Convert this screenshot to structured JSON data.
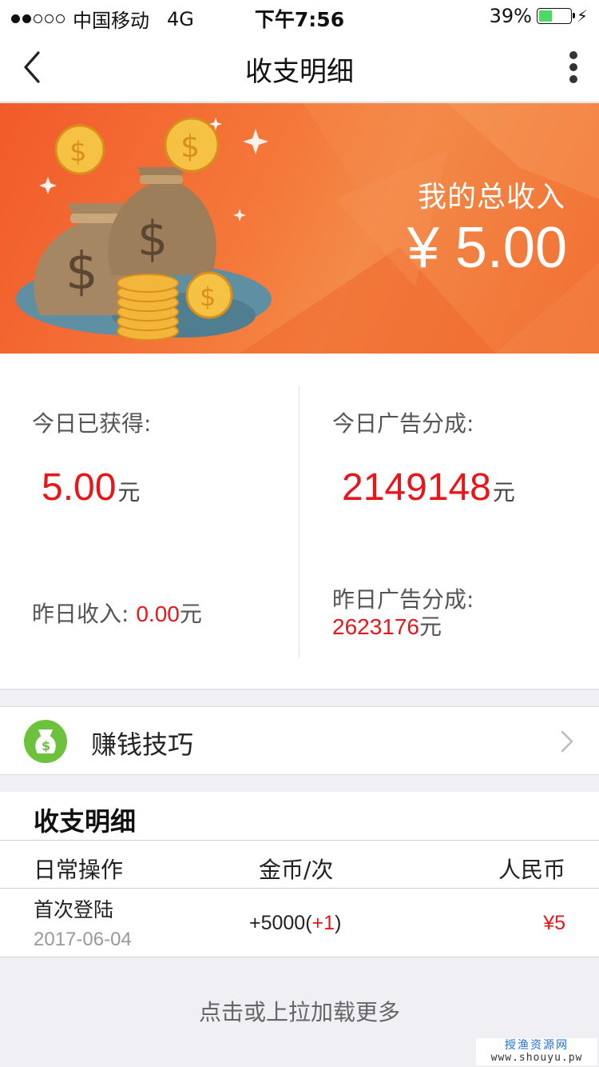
{
  "status_bar": {
    "carrier": "中国移动",
    "network": "4G",
    "time": "下午7:56",
    "battery": "39%",
    "battery_level": 0.39
  },
  "nav": {
    "title": "收支明细"
  },
  "banner": {
    "label": "我的总收入",
    "amount": "¥ 5.00"
  },
  "stats": {
    "today_earned_label": "今日已获得:",
    "today_earned_value": "5.00",
    "yesterday_income_label": "昨日收入:",
    "yesterday_income_value": "0.00",
    "today_ad_share_label": "今日广告分成:",
    "today_ad_share_value": "2149148",
    "yesterday_ad_share_label": "昨日广告分成:",
    "yesterday_ad_share_value": "2623176",
    "unit": "元"
  },
  "tips": {
    "label": "赚钱技巧"
  },
  "detail": {
    "title": "收支明细",
    "columns": [
      "日常操作",
      "金币/次",
      "人民币"
    ],
    "rows": [
      {
        "name": "首次登陆",
        "date": "2017-06-04",
        "coins": "+5000",
        "coins_bonus": "+1",
        "rmb": "¥5"
      }
    ]
  },
  "load_more": "点击或上拉加载更多",
  "watermark": {
    "line1": "授渔资源网",
    "line2": "www.shouyu.pw"
  },
  "colors": {
    "accent_red": "#e8161b",
    "banner_orange": "#f47a3a",
    "tips_green": "#6cc33b"
  }
}
